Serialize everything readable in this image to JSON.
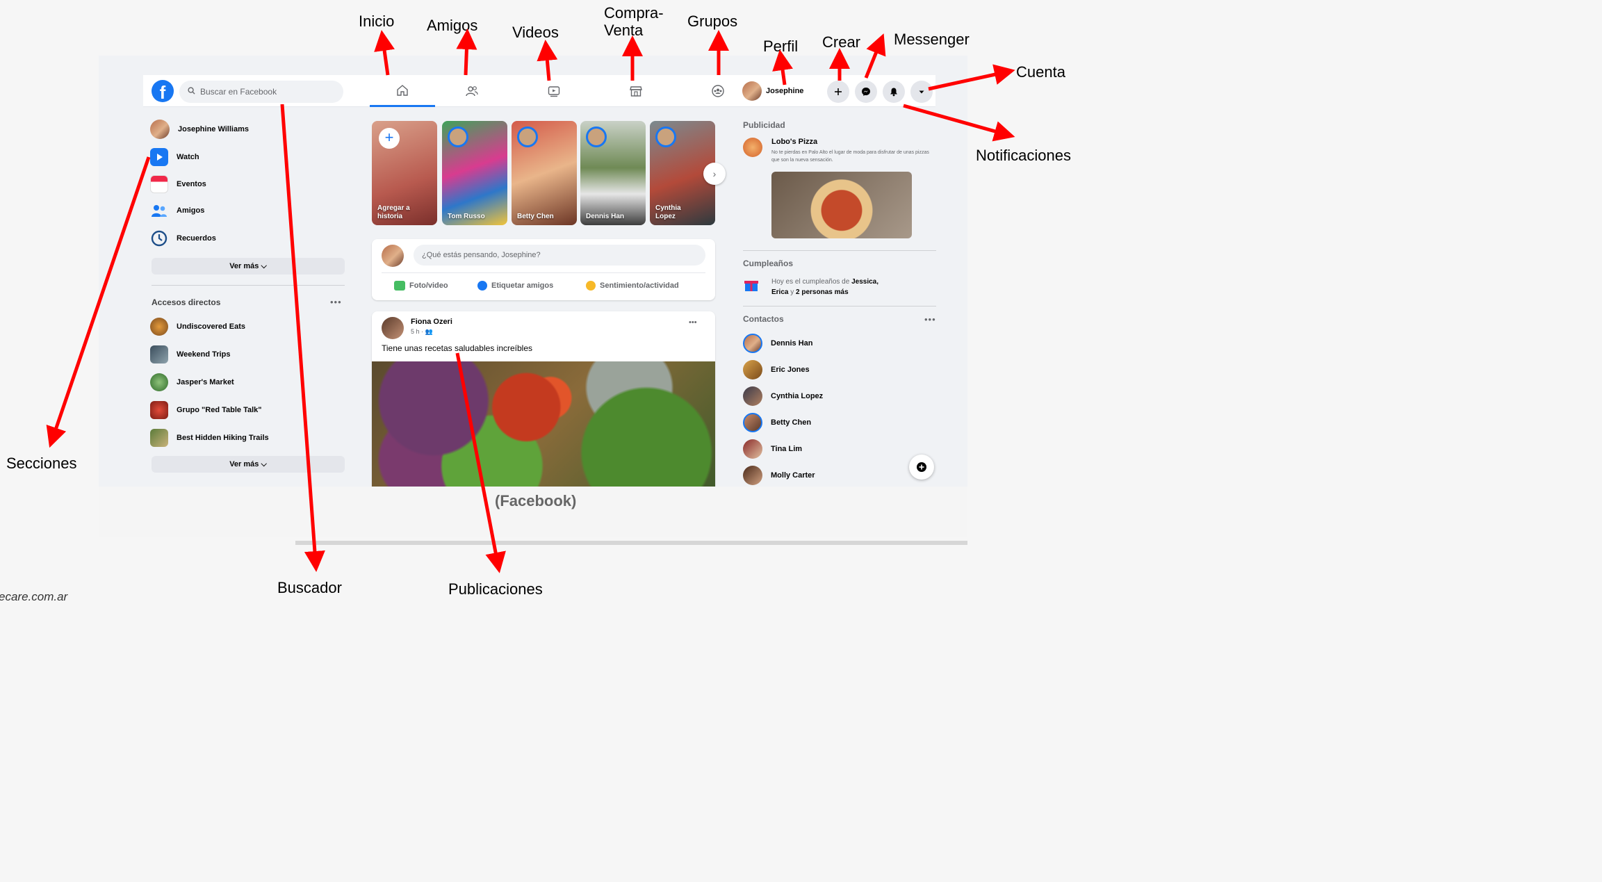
{
  "annotations": {
    "inicio": "Inicio",
    "amigos": "Amigos",
    "videos": "Videos",
    "compra_line1": "Compra-",
    "compra_line2": "Venta",
    "grupos": "Grupos",
    "perfil": "Perfil",
    "crear": "Crear",
    "messenger": "Messenger",
    "cuenta": "Cuenta",
    "notificaciones": "Notificaciones",
    "secciones": "Secciones",
    "buscador": "Buscador",
    "publicaciones": "Publicaciones",
    "source": "ecare.com.ar",
    "caption": "(Facebook)",
    "arrow_color": "#ff0000"
  },
  "topbar": {
    "logo": "f",
    "search_placeholder": "Buscar en Facebook",
    "profile_name": "Josephine",
    "brand_color": "#1877f2"
  },
  "left": {
    "items": [
      {
        "label": "Josephine Williams",
        "icon": "avatar"
      },
      {
        "label": "Watch",
        "icon": "watch-icon"
      },
      {
        "label": "Eventos",
        "icon": "calendar-icon"
      },
      {
        "label": "Amigos",
        "icon": "friends-icon"
      },
      {
        "label": "Recuerdos",
        "icon": "memories-icon"
      }
    ],
    "see_more": "Ver más",
    "shortcuts_title": "Accesos directos",
    "shortcuts": [
      "Undiscovered Eats",
      "Weekend Trips",
      "Jasper's Market",
      "Grupo \"Red Table Talk\"",
      "Best Hidden Hiking Trails"
    ],
    "see_more_2": "Ver más"
  },
  "stories": [
    {
      "line1": "Agregar a",
      "line2": "historia"
    },
    {
      "line1": "Tom Russo",
      "line2": ""
    },
    {
      "line1": "Betty Chen",
      "line2": ""
    },
    {
      "line1": "Dennis Han",
      "line2": ""
    },
    {
      "line1": "Cynthia",
      "line2": "Lopez"
    }
  ],
  "composer": {
    "placeholder": "¿Qué estás pensando, Josephine?",
    "actions": [
      "Foto/video",
      "Etiquetar amigos",
      "Sentimiento/actividad"
    ]
  },
  "post": {
    "author": "Fiona Ozeri",
    "meta": "5 h ·",
    "text": "Tiene unas recetas saludables increíbles"
  },
  "right": {
    "ads_title": "Publicidad",
    "ad_name": "Lobo's Pizza",
    "ad_text": "No te pierdas en Palo Alto el lugar de moda para disfrutar de unas pizzas que son la nueva sensación.",
    "birthdays_title": "Cumpleaños",
    "birthday_prefix": "Hoy es el cumpleaños de",
    "birthday_names": "Jessica,",
    "birthday_line2a": "Erica",
    "birthday_line2b": "y",
    "birthday_line2c": "2 personas más",
    "contacts_title": "Contactos",
    "contacts": [
      "Dennis Han",
      "Eric Jones",
      "Cynthia Lopez",
      "Betty Chen",
      "Tina Lim",
      "Molly Carter"
    ]
  }
}
